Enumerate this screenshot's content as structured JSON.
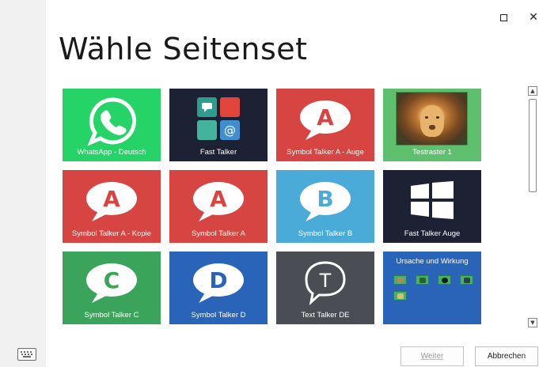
{
  "window": {
    "maximize_glyph": "☐",
    "close_glyph": "✕"
  },
  "page_title": "Wähle Seitenset",
  "tiles": [
    {
      "label": "WhatsApp - Deutsch",
      "color": "#25d366",
      "icon": "whatsapp-icon"
    },
    {
      "label": "Fast Talker",
      "color": "#1c2133",
      "icon": "fast-talker-grid-icon"
    },
    {
      "label": "Symbol Talker A - Auge",
      "color": "#d64541",
      "icon": "speech-bubble-a-icon",
      "letter": "A"
    },
    {
      "label": "Testraster 1",
      "color": "#5ebf6e",
      "icon": "lion-photo"
    },
    {
      "label": "Symbol Talker A - Kopie",
      "color": "#d64541",
      "icon": "speech-bubble-a-icon",
      "letter": "A"
    },
    {
      "label": "Symbol Talker A",
      "color": "#d64541",
      "icon": "speech-bubble-a-icon",
      "letter": "A"
    },
    {
      "label": "Symbol Talker B",
      "color": "#4aabd9",
      "icon": "speech-bubble-b-icon",
      "letter": "B"
    },
    {
      "label": "Fast Talker Auge",
      "color": "#1c2133",
      "icon": "windows-grid-icon"
    },
    {
      "label": "Symbol Talker C",
      "color": "#3aa55a",
      "icon": "speech-bubble-c-icon",
      "letter": "C"
    },
    {
      "label": "Symbol Talker D",
      "color": "#2a64b8",
      "icon": "speech-bubble-d-icon",
      "letter": "D"
    },
    {
      "label": "Text Talker DE",
      "color": "#4a4e54",
      "icon": "text-bubble-t-icon",
      "letter": "T"
    },
    {
      "label": "Ursache und Wirkung",
      "color": "#2a64b8",
      "icon": "cause-effect-icons"
    }
  ],
  "buttons": {
    "next": "Weiter",
    "cancel": "Abbrechen"
  },
  "scrollbar": {
    "up_glyph": "▲",
    "down_glyph": "▼"
  }
}
